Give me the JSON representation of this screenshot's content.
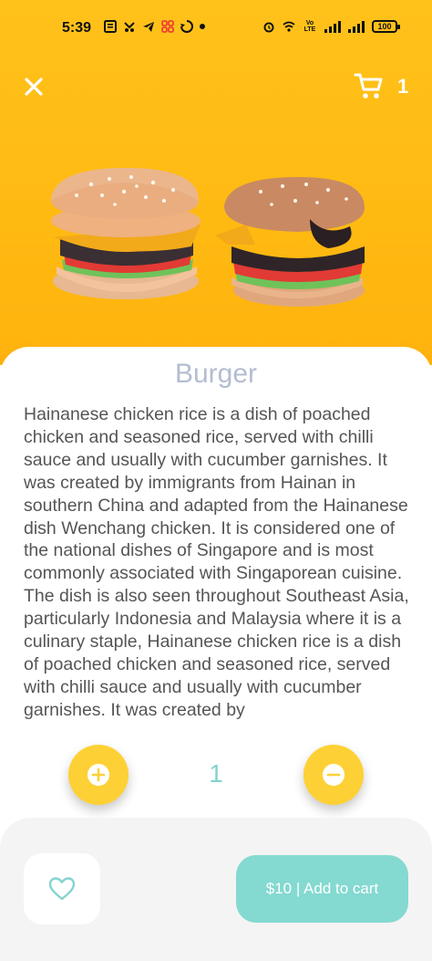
{
  "status_bar": {
    "time": "5:39",
    "battery": "100",
    "icons": [
      "notes-icon",
      "mower-icon",
      "telegram-icon",
      "app-icon",
      "sync-icon",
      "dot-icon",
      "alarm-icon",
      "wifi-icon",
      "volte-icon",
      "signal-icon",
      "signal-icon",
      "battery-icon"
    ],
    "volte_label": "Vo LTE"
  },
  "header": {
    "close_icon": "close-icon",
    "cart_icon": "cart-icon",
    "cart_count": "1"
  },
  "product": {
    "name": "Burger",
    "description": "Hainanese chicken rice is a dish of poached chicken and seasoned rice, served with chilli sauce and usually with cucumber garnishes. It was created by immigrants from Hainan in southern China and adapted from the Hainanese dish Wenchang chicken. It is considered one of the national dishes of Singapore and is most commonly associated with Singaporean cuisine. The dish is also seen throughout Southeast Asia, particularly Indonesia and Malaysia where it is a culinary staple, Hainanese chicken rice is a dish of poached chicken and seasoned rice, served with chilli sauce and usually with cucumber garnishes. It was created by"
  },
  "quantity": {
    "value": "1",
    "plus_icon": "plus-icon",
    "minus_icon": "minus-icon"
  },
  "actions": {
    "favorite_icon": "heart-icon",
    "add_to_cart_label": "$10 | Add to cart"
  },
  "colors": {
    "hero_bg": "#ffc21a",
    "accent_yellow": "#fdd135",
    "accent_teal": "#84d9d0",
    "title_color": "#b3bdd1",
    "text_color": "#555555"
  }
}
